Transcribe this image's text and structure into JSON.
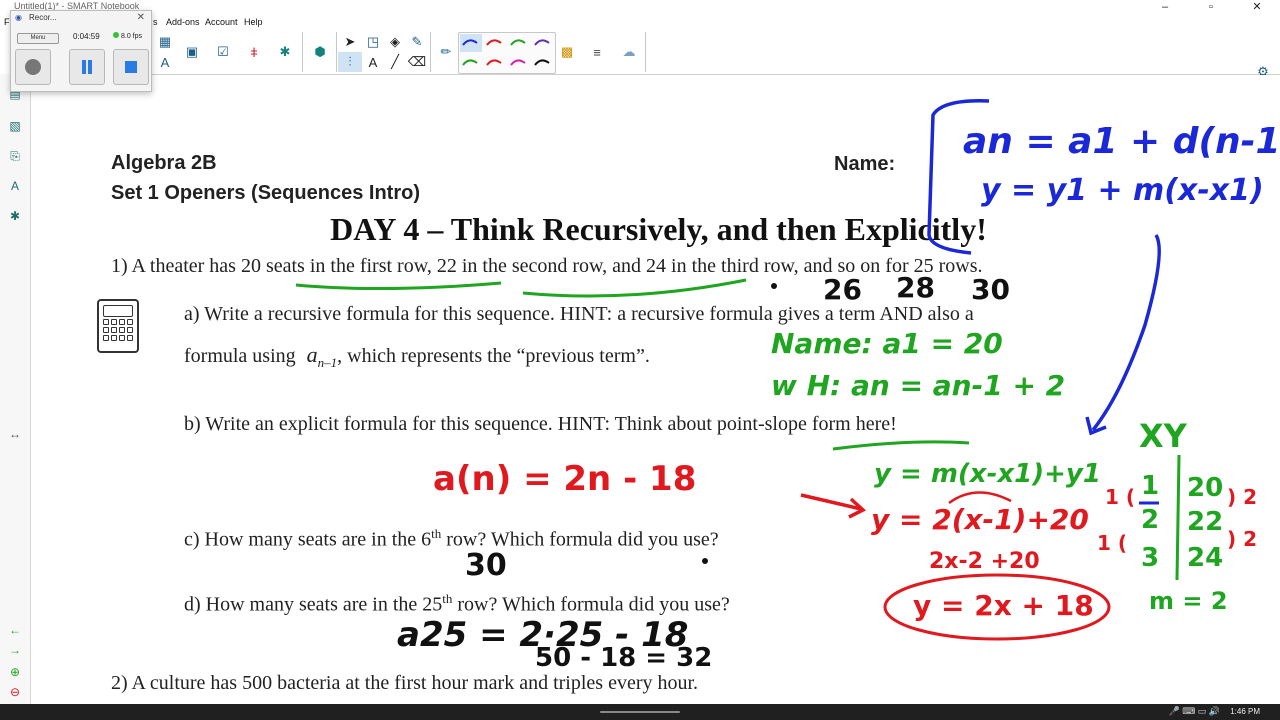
{
  "window": {
    "title": "Untitled(1)* - SMART Notebook"
  },
  "menu": {
    "file": "Fi",
    "s": "s",
    "addons": "Add-ons",
    "account": "Account",
    "help": "Help"
  },
  "recorder": {
    "title": "Recor...",
    "menu": "Menu",
    "time": "0:04:59",
    "fps": "8.0 fps"
  },
  "worksheet": {
    "course": "Algebra 2B",
    "set": "Set 1 Openers (Sequences Intro)",
    "name_label": "Name:",
    "day_title": "DAY 4 – Think Recursively, and then Explicitly!",
    "q1": "1) A theater has 20 seats in the first row, 22 in the second row, and 24 in the third row, and so on for 25 rows.",
    "q1a_line1": "a) Write a recursive formula for this sequence. HINT: a recursive formula gives a term AND also a",
    "q1a_line2_pre": "formula using",
    "q1a_term": "a",
    "q1a_sub": "n–1",
    "q1a_line2_post": ", which represents the “previous term”.",
    "q1b": "b) Write an explicit formula for this sequence. HINT: Think about point-slope form here!",
    "q1c_pre": "c) How many seats are in the 6",
    "q1c_sup": "th",
    "q1c_post": " row?  Which formula did you use?",
    "q1d_pre": "d) How many seats are in the 25",
    "q1d_sup": "th",
    "q1d_post": " row? Which formula did you use?",
    "q2": "2) A culture has 500 bacteria at the first hour mark and triples every hour."
  },
  "handwriting": {
    "blue_formula1": "an = a1 + d(n-1)",
    "blue_formula2": "y = y1 + m(x-x1)",
    "black_26": "26",
    "black_28": "28",
    "black_30": "30",
    "green_name": "Name:  a1 = 20",
    "green_wh": "w H:  an =      an-1 + 2",
    "green_pointslope": "y = m(x-x1)+y1",
    "green_xy": "XY",
    "green_table_x": [
      "1",
      "2",
      "3"
    ],
    "green_table_y": [
      "20",
      "22",
      "24"
    ],
    "green_m": "m = 2",
    "red_explicit": "a(n) = 2n - 18",
    "red_eq1": "y = 2(x-1)+20",
    "red_eq2": "2x-2 +20",
    "red_eq3": "y = 2x + 18",
    "red_left_1": "1 (",
    "red_left_2": "1 (",
    "red_right_1": ") 2",
    "red_right_2": ") 2",
    "black_c_answer": "30",
    "black_a25": "a25 = 2·25 - 18",
    "black_a25_line2": "50 - 18  =  32"
  },
  "taskbar": {
    "clock": "1:46 PM"
  },
  "colors": {
    "blue_ink": "#1a28d8",
    "green_ink": "#1fa51f",
    "red_ink": "#e0191f",
    "black_ink": "#111111"
  }
}
